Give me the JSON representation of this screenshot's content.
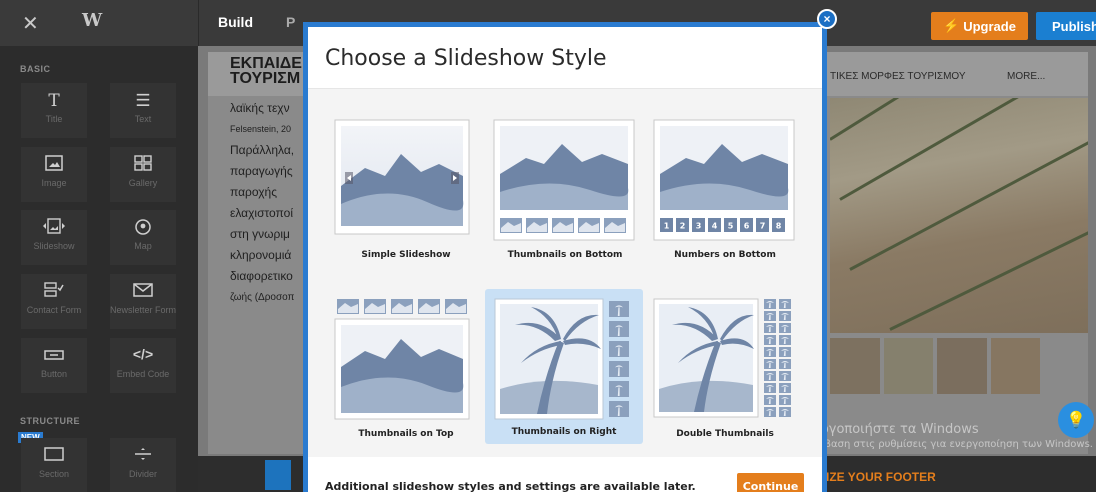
{
  "topbar": {
    "close_icon": "close-icon",
    "logo_icon": "weebly-logo",
    "tabs": [
      "Build",
      "P"
    ],
    "upgrade_label": "Upgrade",
    "publish_label": "Publish",
    "colors": {
      "upgrade": "#e47e1c",
      "publish": "#1b7fd1"
    }
  },
  "sidebar": {
    "basic_label": "BASIC",
    "structure_label": "STRUCTURE",
    "new_badge": "NEW",
    "elements": [
      {
        "label": "Title",
        "icon": "T"
      },
      {
        "label": "Text",
        "icon": "≡"
      },
      {
        "label": "Image",
        "icon": "image"
      },
      {
        "label": "Gallery",
        "icon": "gallery"
      },
      {
        "label": "Slideshow",
        "icon": "slideshow"
      },
      {
        "label": "Map",
        "icon": "map-pin"
      },
      {
        "label": "Contact Form",
        "icon": "contact-form"
      },
      {
        "label": "Newsletter Form",
        "icon": "envelope"
      },
      {
        "label": "Button",
        "icon": "button"
      },
      {
        "label": "Embed Code",
        "icon": "</>"
      },
      {
        "label": "Section",
        "icon": "section"
      },
      {
        "label": "Divider",
        "icon": "divider"
      }
    ]
  },
  "background_page": {
    "site_title": "ΕΚΠΑΙΔΕ ΤΟΥΡΙΣΜ",
    "nav_item": "ΤΙΚΕΣ ΜΟΡΦΕΣ ΤΟΥΡΙΣΜΟΥ",
    "nav_more": "MORE...",
    "text_lines": [
      "λαϊκής τεχν",
      "Felsenstein, 20",
      "Παράλληλα,",
      "παραγωγής",
      "παροχής",
      "ελαχιστοποί",
      "στη γνωριμ",
      "κληρονομιά",
      "διαφορετικο",
      "ζωής (Δροσοπ"
    ],
    "footer_text": "MIZE YOUR FOOTER",
    "watermark_line1": "Ενεργοποιήστε τα Windows",
    "watermark_line2": "Μετάβαση στις ρυθμίσεις για ενεργοποίηση των Windows."
  },
  "modal": {
    "title": "Choose a Slideshow Style",
    "footer_note": "Additional slideshow styles and settings are available later.",
    "continue_label": "Continue",
    "close_label": "×",
    "selected_style": "Thumbnails on Right",
    "styles": [
      {
        "label": "Simple Slideshow"
      },
      {
        "label": "Thumbnails on Bottom"
      },
      {
        "label": "Numbers on Bottom"
      },
      {
        "label": "Thumbnails on Top"
      },
      {
        "label": "Thumbnails on Right"
      },
      {
        "label": "Double Thumbnails"
      }
    ],
    "numbers": [
      "1",
      "2",
      "3",
      "4",
      "5",
      "6",
      "7",
      "8"
    ]
  }
}
